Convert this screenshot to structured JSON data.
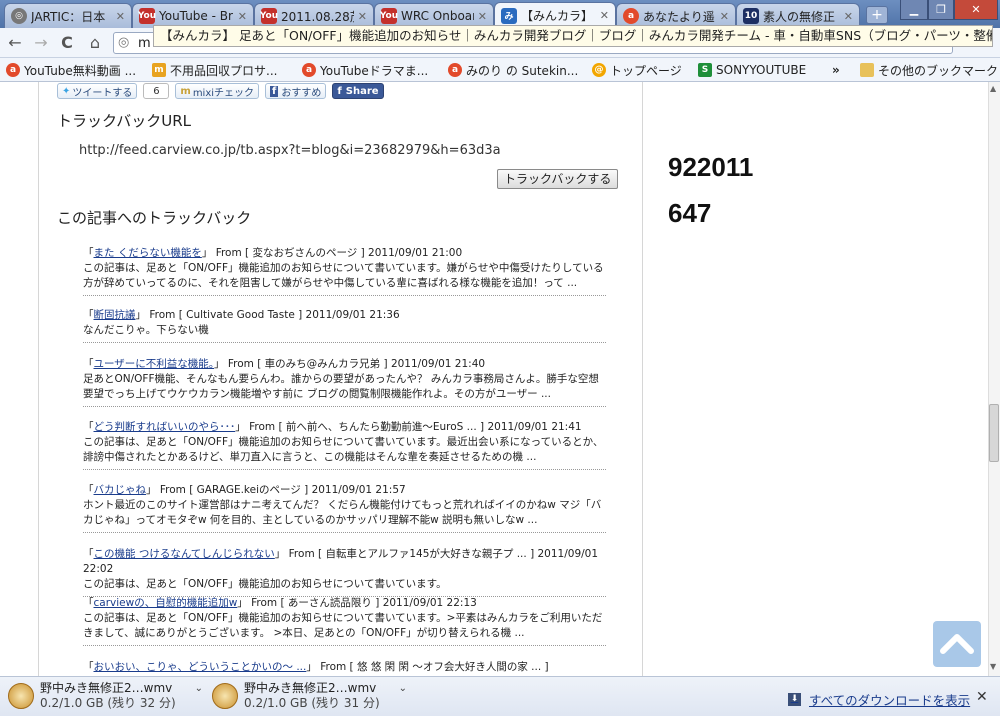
{
  "tabs": [
    {
      "label": "JARTIC：日本",
      "icon": "globe-icon",
      "color": "#5a5a5a"
    },
    {
      "label": "YouTube - Br",
      "icon": "youtube-icon",
      "color": "#c4302b"
    },
    {
      "label": "2011.08.28茂",
      "icon": "youtube-icon",
      "color": "#c4302b"
    },
    {
      "label": "WRC Onboar",
      "icon": "youtube-icon",
      "color": "#c4302b"
    },
    {
      "label": "【みんカラ】",
      "icon": "minkara-icon",
      "color": "#2a6bbf"
    },
    {
      "label": "あなたより遥",
      "icon": "ameba-icon",
      "color": "#e24a2b"
    },
    {
      "label": "素人の無修正",
      "icon": "tv10-icon",
      "color": "#1d2f63"
    }
  ],
  "toolbar": {
    "url_prefix": "m",
    "tooltip": "【みんカラ】 足あと「ON/OFF」機能追加のお知らせ｜みんカラ開発ブログ｜ブログ｜みんカラ開発チーム - 車・自動車SNS（ブログ・パーツ・整備・燃費)"
  },
  "bookmarks": [
    {
      "label": "YouTube無料動画 ...",
      "icon": "ameba-icon"
    },
    {
      "label": "不用品回収プロサ...",
      "icon": "mu-icon"
    },
    {
      "label": "YouTubeドラマま...",
      "icon": "ameba-icon"
    },
    {
      "label": "みのり の Sutekin...",
      "icon": "ameba-icon"
    },
    {
      "label": "トップページ",
      "icon": "at-icon"
    },
    {
      "label": "SONYYOUTUBE",
      "icon": "s-icon"
    },
    {
      "label": "»",
      "icon": ""
    },
    {
      "label": "その他のブックマーク",
      "icon": "folder-icon"
    }
  ],
  "share": {
    "tweet": "ツイートする",
    "count": "6",
    "mixi": "mixiチェック",
    "recommend": "おすすめ",
    "fb": "Share"
  },
  "trackback": {
    "heading": "トラックバックURL",
    "url": "http://feed.carview.co.jp/tb.aspx?t=blog&i=23682979&h=63d3a",
    "button": "トラックバックする",
    "list_heading": "この記事へのトラックバック"
  },
  "items": [
    {
      "title": "また くだらない機能を",
      "from": "From [ 変なおぢさんのページ ] 2011/09/01 21:00",
      "body": "この記事は、足あと「ON/OFF」機能追加のお知らせについて書いています。嫌がらせや中傷受けたりしている方が辞めていってるのに、それを阻害して嫌がらせや中傷している輩に喜ばれる様な機能を追加！って ..."
    },
    {
      "title": "断固抗議",
      "from": "From [ Cultivate Good Taste ] 2011/09/01 21:36",
      "body": "なんだこりゃ。下らない機"
    },
    {
      "title": "ユーザーに不利益な機能。",
      "from": "From [ 車のみち@みんカラ兄弟 ] 2011/09/01 21:40",
      "body": "足あとON/OFF機能、そんなもん要らんわ。誰からの要望があったんや？ みんカラ事務局さんよ。勝手な空想要望でっち上げてウケウカラン機能増やす前に ブログの閲覧制限機能作れよ。その方がユーザー ..."
    },
    {
      "title": "どう判断すればいいのやら･･･",
      "from": "From [ 前へ前へ、ちんたら勤勤前進〜EuroS ... ] 2011/09/01 21:41",
      "body": "この記事は、足あと「ON/OFF」機能追加のお知らせについて書いています。最近出会い系になっているとか、誹謗中傷されたとかあるけど、単刀直入に言うと、この機能はそんな輩を奏延させるための機 ..."
    },
    {
      "title": "バカじゃね",
      "from": "From [ GARAGE.keiのページ ] 2011/09/01 21:57",
      "body": "ホント最近のこのサイト運営部はナニ考えてんだ？ くだらん機能付けてもっと荒れればイイのかねw マジ「バカじゃね」ってオモタぞw 何を目的、主としているのかサッパリ理解不能w 説明も無いしなw ..."
    },
    {
      "title": "この機能 つけるなんてしんじられない",
      "from": "From [ 自転車とアルファ145が大好きな親子プ ... ] 2011/09/01 22:02",
      "body": "この記事は、足あと「ON/OFF」機能追加のお知らせについて書いています。"
    },
    {
      "title": "carviewの、自慰的機能追加w",
      "from": "From [ あーさん読品限り ] 2011/09/01 22:13",
      "body": "この記事は、足あと「ON/OFF」機能追加のお知らせについて書いています。>平素はみんカラをご利用いただきまして、誠にありがとうございます。 >本日、足あとの「ON/OFF」が切り替えられる機 ..."
    },
    {
      "title": "おいおい、こりゃ、どういうことかいの〜 ...",
      "from": "From [ 悠 悠 閑 閑 〜オフ会大好き人間の家 ... ] 2011/09/01",
      "body": ""
    }
  ],
  "right": {
    "num1": "922011",
    "num2": "647"
  },
  "downloads": [
    {
      "name": "野中みき無修正2…wmv",
      "status": "0.2/1.0 GB (残り 32 分)"
    },
    {
      "name": "野中みき無修正2…wmv",
      "status": "0.2/1.0 GB (残り 31 分)"
    }
  ],
  "all_downloads": "すべてのダウンロードを表示"
}
